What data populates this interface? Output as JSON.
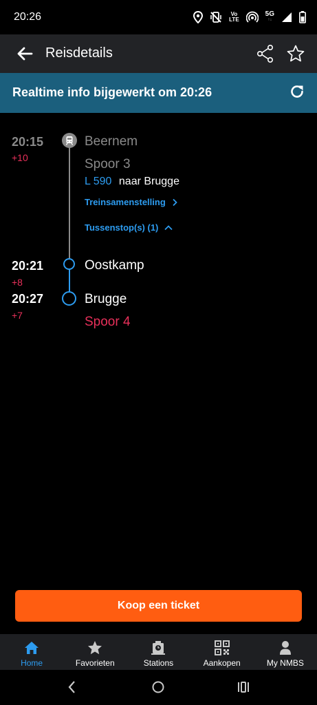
{
  "status_bar": {
    "time": "20:26",
    "network_badge_top": "5G",
    "volte_label": "LTE",
    "icons": [
      "location-icon",
      "vibrate-off-icon",
      "volte-icon",
      "hotspot-icon",
      "signal-icon",
      "battery-icon"
    ]
  },
  "app_bar": {
    "title": "Reisdetails",
    "icons": [
      "arrow-back-icon",
      "share-icon",
      "star-outline-icon"
    ]
  },
  "realtime": {
    "text": "Realtime info bijgewerkt om 20:26",
    "icon": "refresh-icon"
  },
  "journey": {
    "departure": {
      "time": "20:15",
      "delay": "+10",
      "station": "Beernem",
      "platform": "Spoor 3",
      "line_code": "L 590",
      "direction": "naar Brugge"
    },
    "links": {
      "composition": "Treinsamenstelling",
      "intermediate_stops": "Tussenstop(s) (1)"
    },
    "intermediate": {
      "time": "20:21",
      "delay": "+8",
      "station": "Oostkamp"
    },
    "arrival": {
      "time": "20:27",
      "delay": "+7",
      "station": "Brugge",
      "platform": "Spoor 4"
    }
  },
  "buy_button": "Koop een ticket",
  "bottom_nav": [
    {
      "label": "Home",
      "icon": "home-icon",
      "active": true
    },
    {
      "label": "Favorieten",
      "icon": "star-icon",
      "active": false
    },
    {
      "label": "Stations",
      "icon": "station-icon",
      "active": false
    },
    {
      "label": "Aankopen",
      "icon": "qr-code-icon",
      "active": false
    },
    {
      "label": "My NMBS",
      "icon": "person-icon",
      "active": false
    }
  ],
  "colors": {
    "app_bar": "#222326",
    "banner": "#1b5f7d",
    "accent_blue": "#2d9cf0",
    "delay_red": "#e8305a",
    "buy_orange": "#ff5d11",
    "past_gray": "#8a8a8a"
  }
}
